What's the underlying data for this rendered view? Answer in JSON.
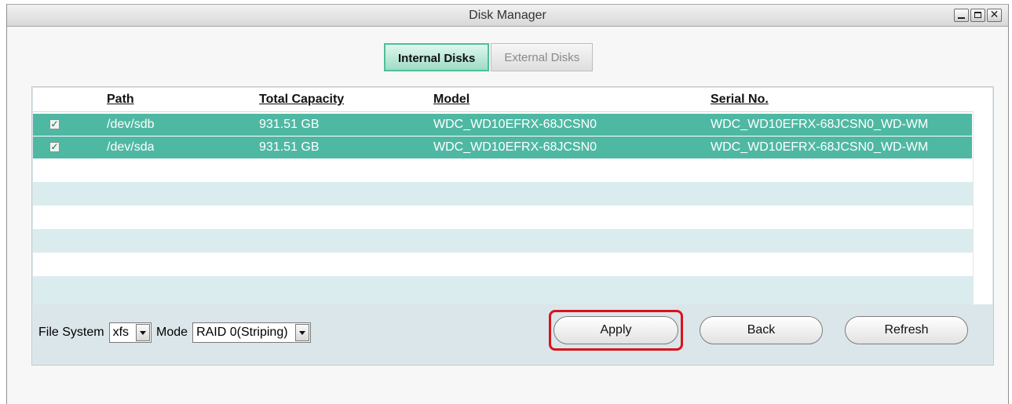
{
  "window": {
    "title": "Disk Manager"
  },
  "tabs": [
    {
      "label": "Internal Disks",
      "active": true
    },
    {
      "label": "External Disks",
      "active": false
    }
  ],
  "table": {
    "headers": [
      "Path",
      "Total Capacity",
      "Model",
      "Serial No."
    ],
    "rows": [
      {
        "checked": true,
        "path": "/dev/sdb",
        "capacity": "931.51 GB",
        "model": "WDC_WD10EFRX-68JCSN0",
        "serial": "WDC_WD10EFRX-68JCSN0_WD-WM"
      },
      {
        "checked": true,
        "path": "/dev/sda",
        "capacity": "931.51 GB",
        "model": "WDC_WD10EFRX-68JCSN0",
        "serial": "WDC_WD10EFRX-68JCSN0_WD-WM"
      }
    ]
  },
  "footer": {
    "filesystem_label": "File System",
    "filesystem_value": "xfs",
    "mode_label": "Mode",
    "mode_value": "RAID 0(Striping)"
  },
  "buttons": {
    "apply": "Apply",
    "back": "Back",
    "refresh": "Refresh"
  },
  "colors": {
    "selected_row": "#4fb8a3",
    "highlight": "#d9141b",
    "active_tab": "#9fdcc6"
  }
}
